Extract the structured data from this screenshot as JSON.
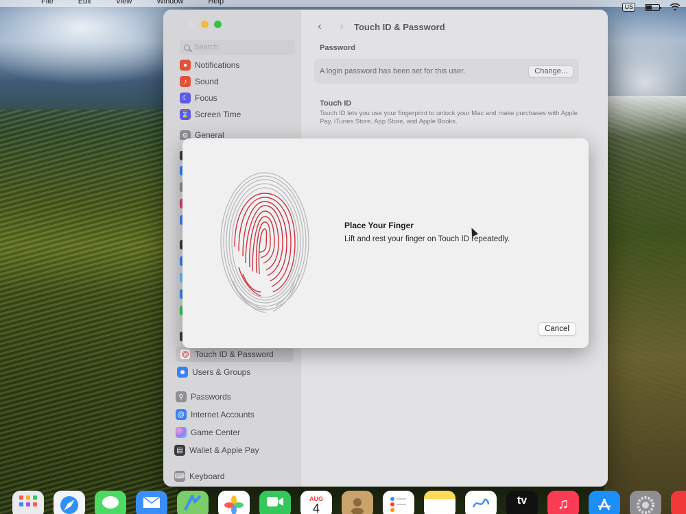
{
  "menubar": {
    "items": [
      "File",
      "Edit",
      "View",
      "Window",
      "Help"
    ],
    "input_source": "US"
  },
  "window": {
    "title": "Touch ID & Password",
    "search_placeholder": "Search",
    "sidebar": {
      "items_top": [
        {
          "label": "Notifications",
          "icon": "bell-icon",
          "color": "#e0523c"
        },
        {
          "label": "Sound",
          "icon": "speaker-icon",
          "color": "#e0523c"
        },
        {
          "label": "Focus",
          "icon": "moon-icon",
          "color": "#5e5ce6"
        },
        {
          "label": "Screen Time",
          "icon": "hourglass-icon",
          "color": "#5e5ce6"
        },
        {
          "label": "General",
          "icon": "gear-icon",
          "color": "#8e8e93"
        }
      ],
      "items_bottom": [
        {
          "label": "Touch ID & Password",
          "icon": "fingerprint-icon",
          "color": "#e05263",
          "selected": true
        },
        {
          "label": "Users & Groups",
          "icon": "users-icon",
          "color": "#3a82f7"
        },
        {
          "label": "Passwords",
          "icon": "key-icon",
          "color": "#8e8e93"
        },
        {
          "label": "Internet Accounts",
          "icon": "at-icon",
          "color": "#3a82f7"
        },
        {
          "label": "Game Center",
          "icon": "game-center-icon",
          "color": "#d96ad3"
        },
        {
          "label": "Wallet & Apple Pay",
          "icon": "wallet-icon",
          "color": "#3a3a3c"
        },
        {
          "label": "Keyboard",
          "icon": "keyboard-icon",
          "color": "#8e8e93"
        }
      ]
    },
    "content": {
      "password_section": "Password",
      "password_text": "A login password has been set for this user.",
      "change_button": "Change...",
      "touch_id_section": "Touch ID",
      "touch_id_desc": "Touch ID lets you use your fingerprint to unlock your Mac and make purchases with Apple Pay, iTunes Store, App Store, and Apple Books."
    }
  },
  "sheet": {
    "title": "Place Your Finger",
    "body": "Lift and rest your finger on Touch ID repeatedly.",
    "cancel": "Cancel",
    "accent_color": "#c8333f"
  },
  "dock": {
    "calendar_month": "AUG",
    "calendar_day": "4",
    "tv_label": "tv",
    "items": [
      {
        "name": "launchpad-icon",
        "color": "#e9e9ee"
      },
      {
        "name": "safari-icon",
        "color": "#f2f4f7"
      },
      {
        "name": "messages-icon",
        "color": "#4cd964"
      },
      {
        "name": "mail-icon",
        "color": "#3a8ef6"
      },
      {
        "name": "maps-icon",
        "color": "#7ccd6a"
      },
      {
        "name": "photos-icon",
        "color": "#ffffff"
      },
      {
        "name": "facetime-icon",
        "color": "#34c759"
      },
      {
        "name": "calendar-icon",
        "color": "#ffffff"
      },
      {
        "name": "contacts-icon",
        "color": "#c9a36b"
      },
      {
        "name": "reminders-icon",
        "color": "#ffffff"
      },
      {
        "name": "notes-icon",
        "color": "#ffd95a"
      },
      {
        "name": "freeform-icon",
        "color": "#ffffff"
      },
      {
        "name": "tv-icon",
        "color": "#111111"
      },
      {
        "name": "music-icon",
        "color": "#fa3b54"
      },
      {
        "name": "app-store-icon",
        "color": "#1c8ef9"
      },
      {
        "name": "system-settings-icon",
        "color": "#8e8e93"
      },
      {
        "name": "news-icon",
        "color": "#f03a3a"
      }
    ]
  }
}
